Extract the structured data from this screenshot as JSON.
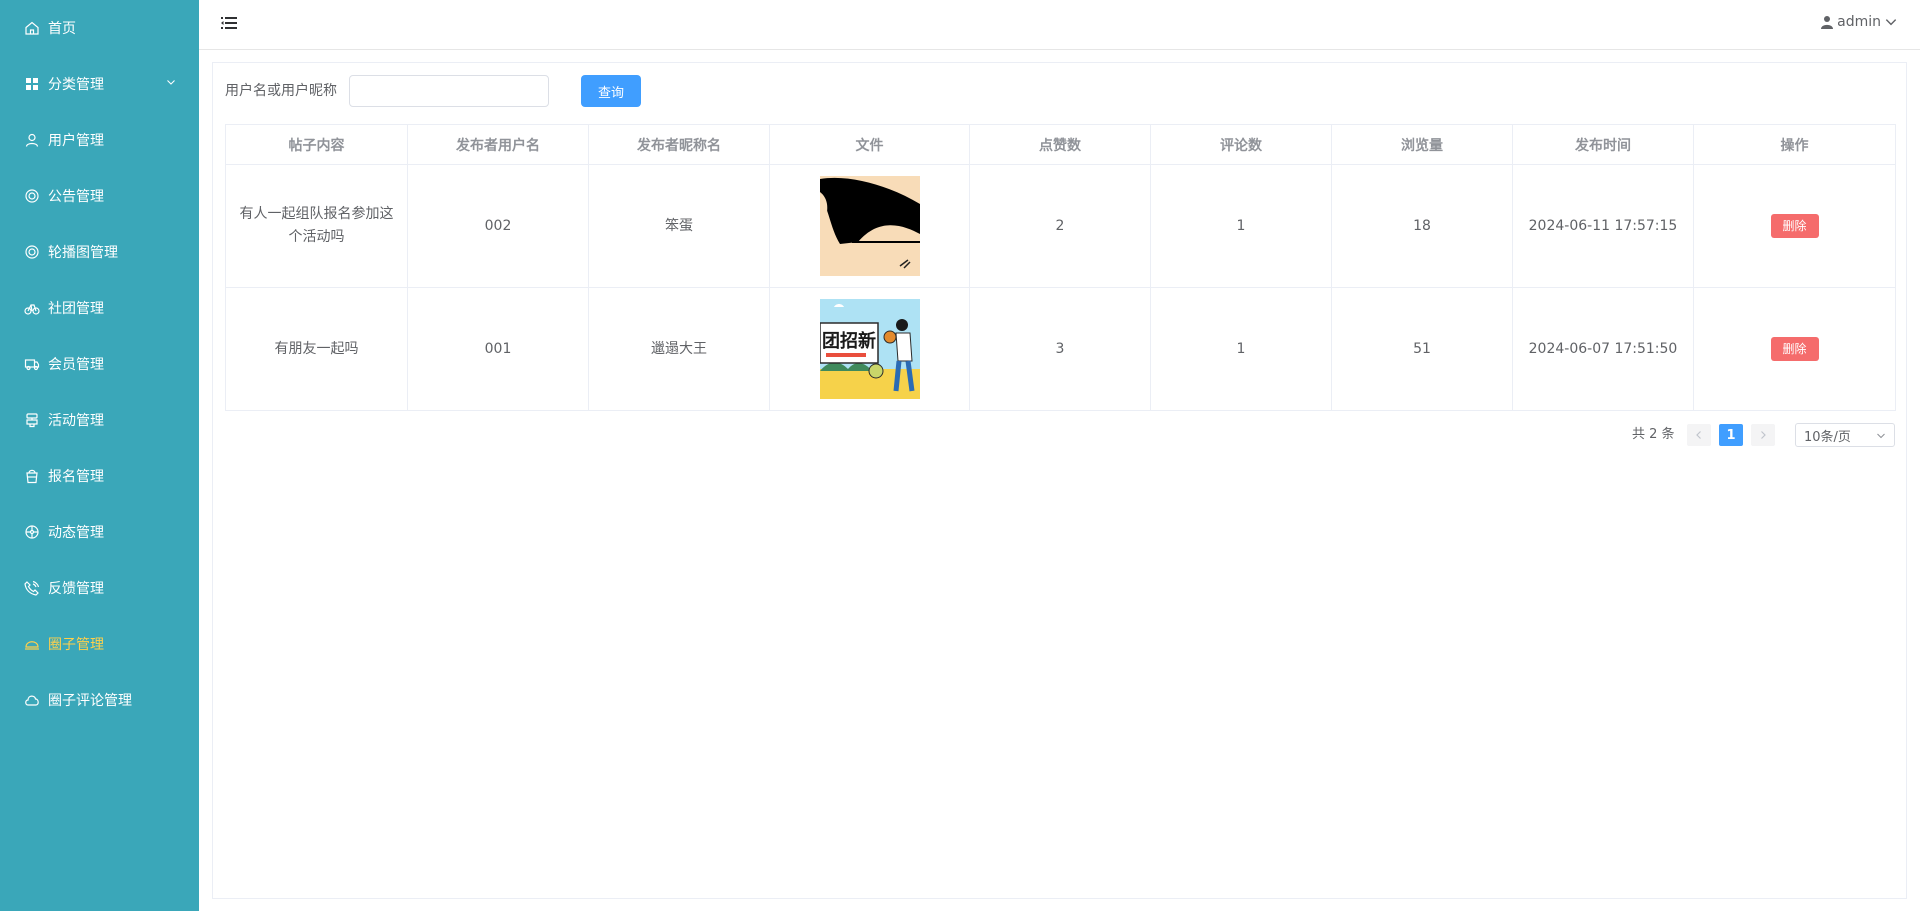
{
  "sidebar": {
    "items": [
      {
        "label": "首页",
        "icon": "home-icon"
      },
      {
        "label": "分类管理",
        "icon": "grid-icon"
      },
      {
        "label": "用户管理",
        "icon": "user-icon"
      },
      {
        "label": "公告管理",
        "icon": "notice-icon"
      },
      {
        "label": "轮播图管理",
        "icon": "carousel-icon"
      },
      {
        "label": "社团管理",
        "icon": "club-icon"
      },
      {
        "label": "会员管理",
        "icon": "member-icon"
      },
      {
        "label": "活动管理",
        "icon": "activity-icon"
      },
      {
        "label": "报名管理",
        "icon": "signup-icon"
      },
      {
        "label": "动态管理",
        "icon": "dynamic-icon"
      },
      {
        "label": "反馈管理",
        "icon": "feedback-icon"
      },
      {
        "label": "圈子管理",
        "icon": "circle-icon"
      },
      {
        "label": "圈子评论管理",
        "icon": "comment-icon"
      }
    ],
    "active_color": "#ffd04b",
    "bg_color": "#3aa7b9"
  },
  "header": {
    "user_name": "admin"
  },
  "search": {
    "label": "用户名或用户昵称",
    "value": "",
    "placeholder": "",
    "button_label": "查询"
  },
  "table": {
    "headers": [
      "帖子内容",
      "发布者用户名",
      "发布者昵称名",
      "文件",
      "点赞数",
      "评论数",
      "浏览量",
      "发布时间",
      "操作"
    ],
    "rows": [
      {
        "content": "有人一起组队报名参加这个活动吗",
        "username": "002",
        "nickname": "笨蛋",
        "likes": "2",
        "comments": "1",
        "views": "18",
        "time": "2024-06-11 17:57:15",
        "action": "删除"
      },
      {
        "content": "有朋友一起吗",
        "username": "001",
        "nickname": "邋遢大王",
        "likes": "3",
        "comments": "1",
        "views": "51",
        "time": "2024-06-07 17:51:50",
        "action": "删除"
      }
    ],
    "image_text": "团招新"
  },
  "pagination": {
    "total": "共 2 条",
    "current": "1",
    "page_size": "10条/页"
  }
}
